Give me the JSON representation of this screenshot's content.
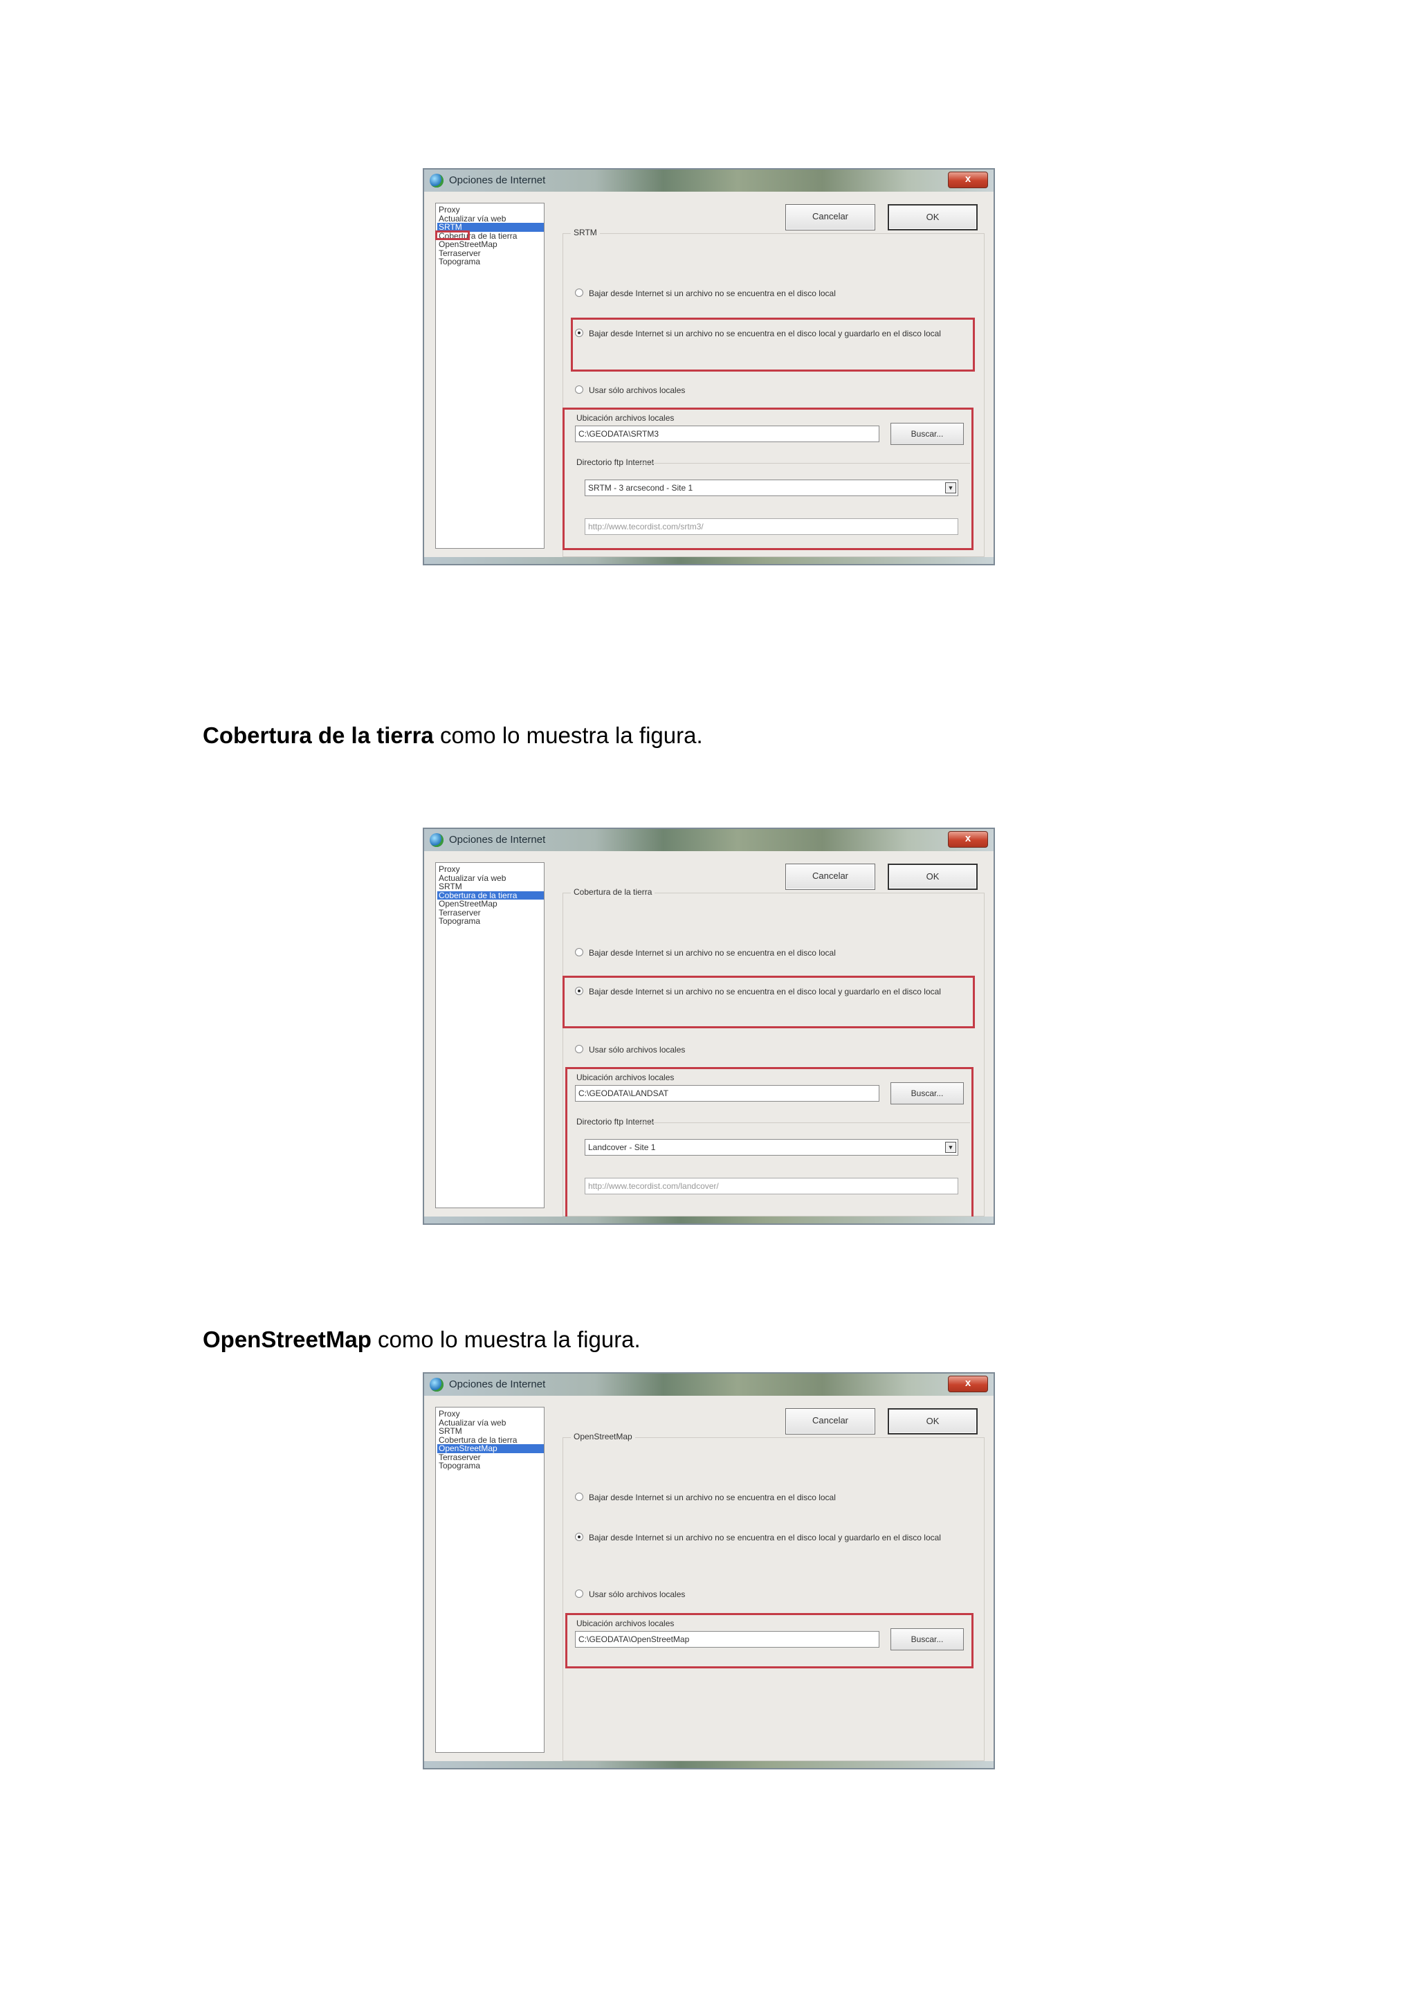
{
  "dialogs": [
    {
      "title": "Opciones de Internet",
      "close_label": "x",
      "list_items": [
        "Proxy",
        "Actualizar vía web",
        "SRTM",
        "Cobertura de la tierra",
        "OpenStreetMap",
        "Terraserver",
        "Topograma"
      ],
      "selected_index": 2,
      "cancel_label": "Cancelar",
      "ok_label": "OK",
      "group_title": "SRTM",
      "radio1": "Bajar desde Internet si un archivo no se encuentra en el disco local",
      "radio2": "Bajar desde Internet si un archivo no se encuentra en el disco local y guardarlo en el disco local",
      "radio3": "Usar sólo archivos locales",
      "local_label": "Ubicación archivos locales",
      "local_path": "C:\\GEODATA\\SRTM3",
      "browse_label": "Buscar...",
      "ftp_label": "Directorio ftp Internet",
      "ftp_select": "SRTM - 3 arcsecond - Site 1",
      "ftp_url": "http://www.tecordist.com/srtm3/"
    },
    {
      "title": "Opciones de Internet",
      "close_label": "x",
      "list_items": [
        "Proxy",
        "Actualizar vía web",
        "SRTM",
        "Cobertura de la tierra",
        "OpenStreetMap",
        "Terraserver",
        "Topograma"
      ],
      "selected_index": 3,
      "cancel_label": "Cancelar",
      "ok_label": "OK",
      "group_title": "Cobertura de la tierra",
      "radio1": "Bajar desde Internet si un archivo no se encuentra en el disco local",
      "radio2": "Bajar desde Internet si un archivo no se encuentra en el disco local y guardarlo en el disco local",
      "radio3": "Usar sólo archivos locales",
      "local_label": "Ubicación archivos locales",
      "local_path": "C:\\GEODATA\\LANDSAT",
      "browse_label": "Buscar...",
      "ftp_label": "Directorio ftp Internet",
      "ftp_select": "Landcover - Site 1",
      "ftp_url": "http://www.tecordist.com/landcover/"
    },
    {
      "title": "Opciones de Internet",
      "close_label": "x",
      "list_items": [
        "Proxy",
        "Actualizar vía web",
        "SRTM",
        "Cobertura de la tierra",
        "OpenStreetMap",
        "Terraserver",
        "Topograma"
      ],
      "selected_index": 4,
      "cancel_label": "Cancelar",
      "ok_label": "OK",
      "group_title": "OpenStreetMap",
      "radio1": "Bajar desde Internet si un archivo no se encuentra en el disco local",
      "radio2": "Bajar desde Internet si un archivo no se encuentra en el disco local y guardarlo en el disco local",
      "radio3": "Usar sólo archivos locales",
      "local_label": "Ubicación archivos locales",
      "local_path": "C:\\GEODATA\\OpenStreetMap",
      "browse_label": "Buscar..."
    }
  ],
  "captions": [
    {
      "bold": "Cobertura de la  tierra",
      "rest": " como lo muestra la figura."
    },
    {
      "bold": "OpenStreetMap",
      "rest": " como lo muestra la figura."
    }
  ],
  "colors": {
    "highlight_box": "#c43b46",
    "selection": "#3a75d6"
  }
}
